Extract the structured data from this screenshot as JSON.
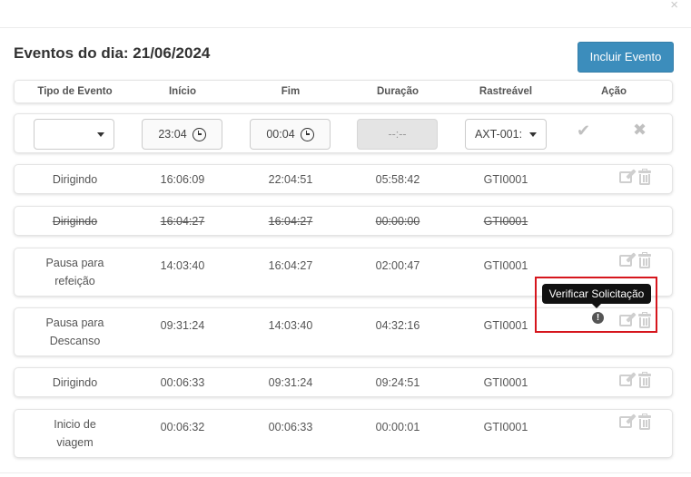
{
  "modal": {
    "close_symbol": "×",
    "title": "Eventos do dia: 21/06/2024",
    "add_button": "Incluir Evento"
  },
  "columns": [
    "Tipo de Evento",
    "Início",
    "Fim",
    "Duração",
    "Rastreável",
    "Ação"
  ],
  "new_row": {
    "tipo_value": "",
    "inicio_value": "23:04",
    "fim_value": "00:04",
    "duracao_value": "--:--",
    "rastreavel_value": "AXT-001:",
    "confirm_symbol": "✔",
    "cancel_symbol": "✖"
  },
  "events": [
    {
      "tipo": "Dirigindo",
      "inicio": "16:06:09",
      "fim": "22:04:51",
      "duracao": "05:58:42",
      "rastreavel": "GTI0001"
    },
    {
      "tipo": "Dirigindo",
      "inicio": "16:04:27",
      "fim": "16:04:27",
      "duracao": "00:00:00",
      "rastreavel": "GTI0001"
    },
    {
      "tipo": "Pausa para refeição",
      "inicio": "14:03:40",
      "fim": "16:04:27",
      "duracao": "02:00:47",
      "rastreavel": "GTI0001"
    },
    {
      "tipo": "Pausa para Descanso",
      "inicio": "09:31:24",
      "fim": "14:03:40",
      "duracao": "04:32:16",
      "rastreavel": "GTI0001",
      "alert_symbol": "!"
    },
    {
      "tipo": "Dirigindo",
      "inicio": "00:06:33",
      "fim": "09:31:24",
      "duracao": "09:24:51",
      "rastreavel": "GTI0001"
    },
    {
      "tipo": "Inicio de viagem",
      "inicio": "00:06:32",
      "fim": "00:06:33",
      "duracao": "00:00:01",
      "rastreavel": "GTI0001"
    }
  ],
  "tooltip": "Verificar Solicitação",
  "colors": {
    "primary_button": "#3c8dbc",
    "highlight_border": "#d6161d",
    "tooltip_bg": "#111111",
    "icon_gray": "#cfcfcf"
  }
}
